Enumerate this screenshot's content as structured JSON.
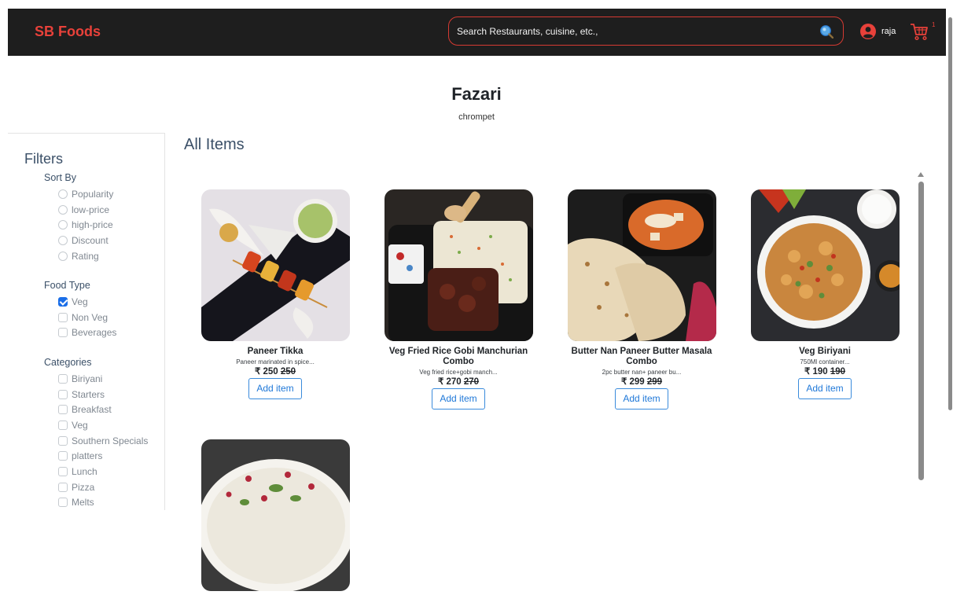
{
  "header": {
    "brand": "SB Foods",
    "search_placeholder": "Search Restaurants, cuisine, etc.,",
    "user_name": "raja",
    "cart_count": "1"
  },
  "restaurant": {
    "name": "Fazari",
    "location": "chrompet"
  },
  "filters": {
    "title": "Filters",
    "sort_by": {
      "title": "Sort By",
      "options": [
        "Popularity",
        "low-price",
        "high-price",
        "Discount",
        "Rating"
      ]
    },
    "food_type": {
      "title": "Food Type",
      "options": [
        "Veg",
        "Non Veg",
        "Beverages"
      ],
      "checked": [
        true,
        false,
        false
      ]
    },
    "categories": {
      "title": "Categories",
      "options": [
        "Biriyani",
        "Starters",
        "Breakfast",
        "Veg",
        "Southern Specials",
        "platters",
        "Lunch",
        "Pizza",
        "Melts"
      ]
    }
  },
  "main": {
    "title": "All Items",
    "items": [
      {
        "name": "Paneer Tikka",
        "desc": "Paneer marinated in spice...",
        "price": "₹ 250",
        "orig": "250",
        "button": "Add item"
      },
      {
        "name": "Veg Fried Rice Gobi Manchurian Combo",
        "desc": "Veg fried rice+gobi manch...",
        "price": "₹ 270",
        "orig": "270",
        "button": "Add item"
      },
      {
        "name": "Butter Nan Paneer Butter Masala Combo",
        "desc": "2pc butter nan+ paneer bu...",
        "price": "₹ 299",
        "orig": "299",
        "button": "Add item"
      },
      {
        "name": "Veg Biriyani",
        "desc": "750Ml container...",
        "price": "₹ 190",
        "orig": "190",
        "button": "Add item"
      }
    ]
  },
  "colors": {
    "header_bg": "#1e1e1e",
    "brand": "#e8413a",
    "accent_blue": "#1a6ee8",
    "heading": "#3b5068"
  },
  "icons": {
    "search": "search-icon",
    "user": "user-circle-icon",
    "cart": "cart-icon"
  }
}
